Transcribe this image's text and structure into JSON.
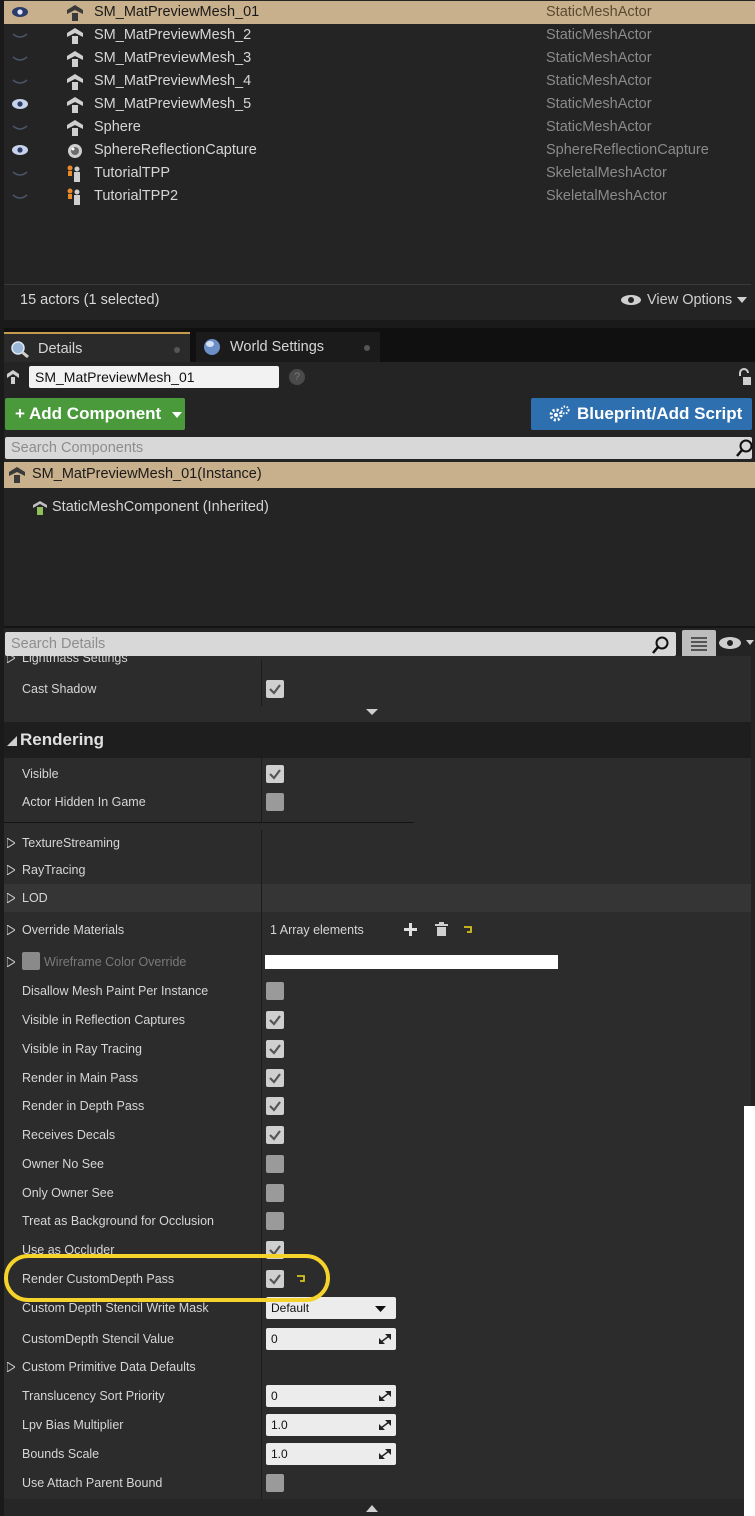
{
  "outliner": {
    "rows": [
      {
        "name": "SM_MatPreviewMesh_01",
        "type": "StaticMeshActor",
        "visible": true,
        "selected": true
      },
      {
        "name": "SM_MatPreviewMesh_2",
        "type": "StaticMeshActor",
        "visible": false,
        "selected": false
      },
      {
        "name": "SM_MatPreviewMesh_3",
        "type": "StaticMeshActor",
        "visible": false,
        "selected": false
      },
      {
        "name": "SM_MatPreviewMesh_4",
        "type": "StaticMeshActor",
        "visible": false,
        "selected": false
      },
      {
        "name": "SM_MatPreviewMesh_5",
        "type": "StaticMeshActor",
        "visible": true,
        "selected": false
      },
      {
        "name": "Sphere",
        "type": "StaticMeshActor",
        "visible": false,
        "selected": false
      },
      {
        "name": "SphereReflectionCapture",
        "type": "SphereReflectionCapture",
        "visible": true,
        "selected": false
      },
      {
        "name": "TutorialTPP",
        "type": "SkeletalMeshActor",
        "visible": false,
        "selected": false
      },
      {
        "name": "TutorialTPP2",
        "type": "SkeletalMeshActor",
        "visible": false,
        "selected": false
      }
    ],
    "actor_count": "15 actors (1 selected)",
    "view_options": "View Options"
  },
  "tabs": {
    "details": "Details",
    "world_settings": "World Settings"
  },
  "details": {
    "actor_name": "SM_MatPreviewMesh_01",
    "help_glyph": "?",
    "add_component": "+ Add Component",
    "blueprint_add_script": "Blueprint/Add Script",
    "search_components_placeholder": "Search Components",
    "instance_row": "SM_MatPreviewMesh_01(Instance)",
    "component_row": "StaticMeshComponent (Inherited)",
    "search_details_placeholder": "Search Details"
  },
  "properties": {
    "lightmass_settings": "Lightmass Settings",
    "cast_shadow": "Cast Shadow",
    "rendering_header": "Rendering",
    "visible": "Visible",
    "actor_hidden_in_game": "Actor Hidden In Game",
    "texture_streaming": "TextureStreaming",
    "ray_tracing": "RayTracing",
    "lod": "LOD",
    "override_materials": "Override Materials",
    "override_materials_value": "1 Array elements",
    "wireframe_color_override": "Wireframe Color Override",
    "disallow_mesh_paint": "Disallow Mesh Paint Per Instance",
    "visible_in_reflection_captures": "Visible in Reflection Captures",
    "visible_in_ray_tracing": "Visible in Ray Tracing",
    "render_in_main_pass": "Render in Main Pass",
    "render_in_depth_pass": "Render in Depth Pass",
    "receives_decals": "Receives Decals",
    "owner_no_see": "Owner No See",
    "only_owner_see": "Only Owner See",
    "treat_as_background": "Treat as Background for Occlusion",
    "use_as_occluder": "Use as Occluder",
    "render_customdepth_pass": "Render CustomDepth Pass",
    "custom_depth_stencil_write_mask": "Custom Depth Stencil Write Mask",
    "custom_depth_stencil_write_mask_value": "Default",
    "customdepth_stencil_value": "CustomDepth Stencil Value",
    "customdepth_stencil_value_value": "0",
    "custom_primitive_data_defaults": "Custom Primitive Data Defaults",
    "translucency_sort_priority": "Translucency Sort Priority",
    "translucency_sort_priority_value": "0",
    "lpv_bias_multiplier": "Lpv Bias Multiplier",
    "lpv_bias_multiplier_value": "1.0",
    "bounds_scale": "Bounds Scale",
    "bounds_scale_value": "1.0",
    "use_attach_parent_bound": "Use Attach Parent Bound"
  },
  "checkbox_states": {
    "cast_shadow": true,
    "visible": true,
    "actor_hidden_in_game": false,
    "disallow_mesh_paint": false,
    "visible_in_reflection_captures": true,
    "visible_in_ray_tracing": true,
    "render_in_main_pass": true,
    "render_in_depth_pass": true,
    "receives_decals": true,
    "owner_no_see": false,
    "only_owner_see": false,
    "treat_as_background": false,
    "use_as_occluder": true,
    "render_customdepth_pass": true,
    "use_attach_parent_bound": false
  },
  "colors": {
    "selection": "#c9b08c",
    "add_component": "#4a9a3c",
    "blueprint": "#2e6fb0",
    "highlight": "#f5d32a",
    "reset_arrow": "#d8c21e"
  }
}
